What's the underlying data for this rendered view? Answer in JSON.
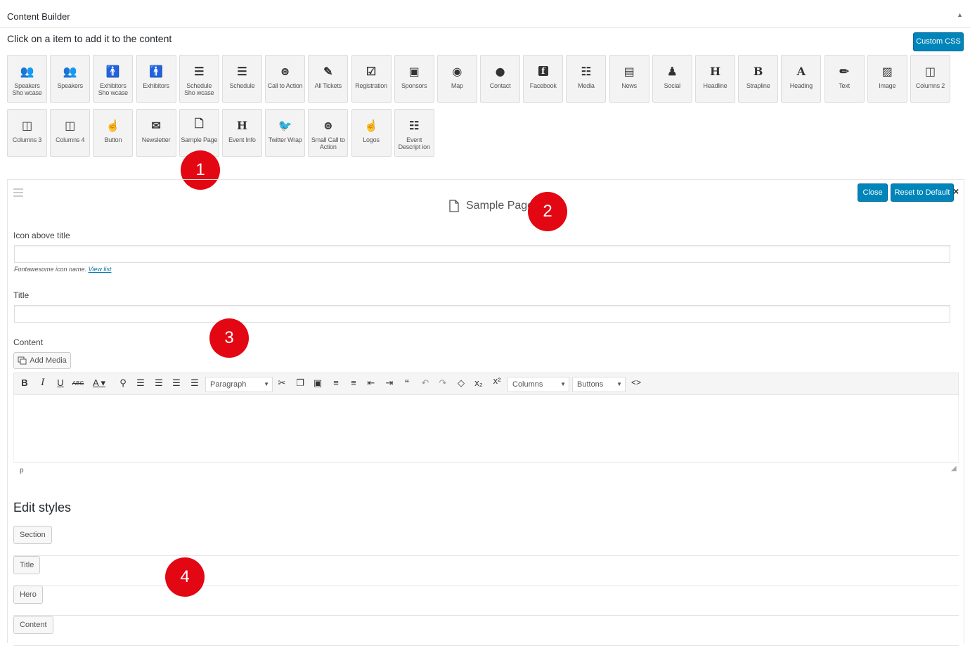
{
  "panel": {
    "title": "Content Builder",
    "toggle_glyph": "▲"
  },
  "builder": {
    "instructions": "Click on a item to add it to the content",
    "custom_css_label": "Custom CSS",
    "row1": [
      {
        "label": "Speakers Sho wcase",
        "icon": "users-icon"
      },
      {
        "label": "Speakers",
        "icon": "users-icon"
      },
      {
        "label": "Exhibitors Sho wcase",
        "icon": "male-icon"
      },
      {
        "label": "Exhibitors",
        "icon": "male-icon"
      },
      {
        "label": "Schedule Sho wcase",
        "icon": "server-icon"
      },
      {
        "label": "Schedule",
        "icon": "server-icon"
      },
      {
        "label": "Call to Action",
        "icon": "gamepad-icon"
      },
      {
        "label": "All Tickets",
        "icon": "ticket-icon"
      },
      {
        "label": "Registration",
        "icon": "check-square-icon"
      },
      {
        "label": "Sponsors",
        "icon": "money-icon"
      },
      {
        "label": "Map",
        "icon": "dot-circle-icon"
      },
      {
        "label": "Contact",
        "icon": "comment-icon"
      },
      {
        "label": "Facebook",
        "icon": "facebook-icon"
      },
      {
        "label": "Media",
        "icon": "list-icon"
      },
      {
        "label": "News",
        "icon": "newspaper-icon"
      },
      {
        "label": "Social",
        "icon": "user-plus-icon"
      },
      {
        "label": "Headline",
        "icon": "letter-h-icon"
      },
      {
        "label": "Strapline",
        "icon": "letter-b-icon"
      },
      {
        "label": "Heading",
        "icon": "letter-a-icon"
      },
      {
        "label": "Text",
        "icon": "pencil-icon"
      },
      {
        "label": "Image",
        "icon": "image-icon"
      },
      {
        "label": "Columns 2",
        "icon": "columns-icon"
      }
    ],
    "row2": [
      {
        "label": "Columns 3",
        "icon": "columns-icon"
      },
      {
        "label": "Columns 4",
        "icon": "columns-icon"
      },
      {
        "label": "Button",
        "icon": "hand-pointer-icon"
      },
      {
        "label": "Newsletter",
        "icon": "envelope-icon"
      },
      {
        "label": "Sample Page",
        "icon": "file-icon"
      },
      {
        "label": "Event Info",
        "icon": "letter-h-icon"
      },
      {
        "label": "Twitter Wrap",
        "icon": "twitter-icon"
      },
      {
        "label": "Small Call to Action",
        "icon": "gamepad-icon"
      },
      {
        "label": "Logos",
        "icon": "hand-pointer-icon"
      },
      {
        "label": "Event Descript ion",
        "icon": "list-icon"
      }
    ]
  },
  "markers": [
    "1",
    "2",
    "3",
    "4"
  ],
  "editor": {
    "title": "Sample Page",
    "close_label": "Close",
    "reset_label": "Reset to Default",
    "close_glyph": "×",
    "icon_label": "Icon above title",
    "icon_value": "",
    "icon_help": "Fontawesome icon name.",
    "icon_help_link": "View list",
    "title_label": "Title",
    "title_value": "",
    "content_label": "Content",
    "add_media_label": "Add Media",
    "toolbar": {
      "format_select": "Paragraph",
      "columns_select": "Columns",
      "buttons_select": "Buttons"
    },
    "path_text": "p"
  },
  "styles": {
    "heading": "Edit styles",
    "buttons": [
      "Section",
      "Title",
      "Hero",
      "Content"
    ]
  },
  "colors": {
    "primary": "#0085ba",
    "marker": "#e30613"
  }
}
